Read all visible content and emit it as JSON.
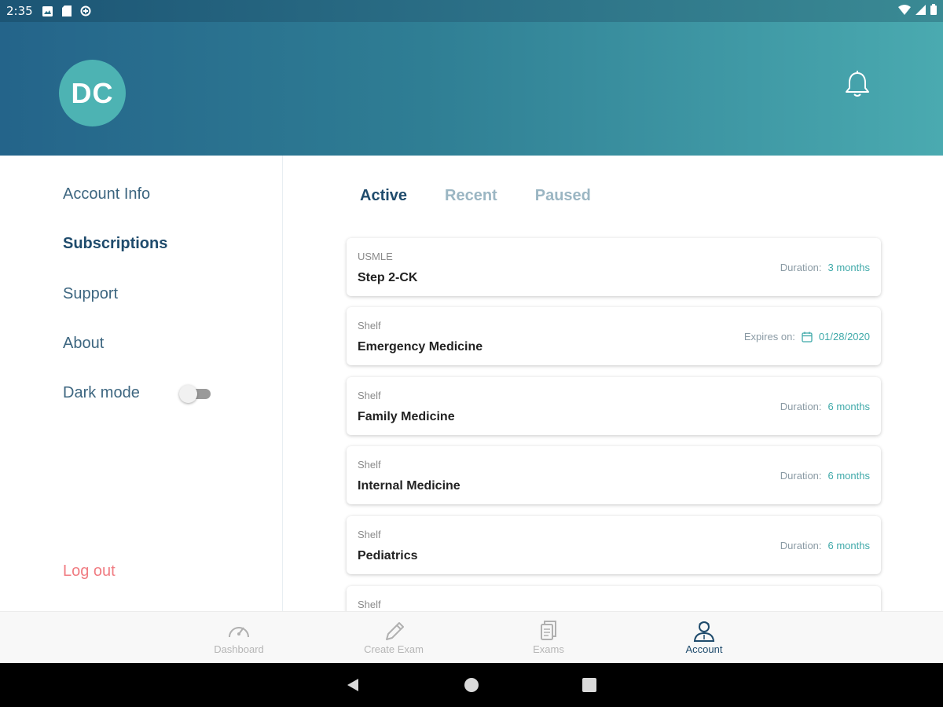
{
  "status_bar": {
    "time": "2:35"
  },
  "header": {
    "avatar_initials": "DC"
  },
  "sidebar": {
    "items": [
      {
        "label": "Account Info"
      },
      {
        "label": "Subscriptions"
      },
      {
        "label": "Support"
      },
      {
        "label": "About"
      },
      {
        "label": "Dark mode"
      }
    ],
    "dark_mode_on": false,
    "logout_label": "Log out"
  },
  "tabs": [
    {
      "label": "Active"
    },
    {
      "label": "Recent"
    },
    {
      "label": "Paused"
    }
  ],
  "subscriptions": [
    {
      "category": "USMLE",
      "name": "Step 2-CK",
      "meta_label": "Duration:",
      "meta_value": "3 months"
    },
    {
      "category": "Shelf",
      "name": "Emergency Medicine",
      "meta_label": "Expires on:",
      "meta_value": "01/28/2020"
    },
    {
      "category": "Shelf",
      "name": "Family Medicine",
      "meta_label": "Duration:",
      "meta_value": "6 months"
    },
    {
      "category": "Shelf",
      "name": "Internal Medicine",
      "meta_label": "Duration:",
      "meta_value": "6 months"
    },
    {
      "category": "Shelf",
      "name": "Pediatrics",
      "meta_label": "Duration:",
      "meta_value": "6 months"
    },
    {
      "category": "Shelf"
    }
  ],
  "bottom_nav": [
    {
      "label": "Dashboard"
    },
    {
      "label": "Create Exam"
    },
    {
      "label": "Exams"
    },
    {
      "label": "Account"
    }
  ],
  "colors": {
    "accent": "#3fa9a9",
    "primary_text": "#1f4b6c",
    "logout": "#f07c82",
    "avatar": "#4db3b3"
  },
  "icons": [
    "bell-icon",
    "dashboard-gauge-icon",
    "pencil-icon",
    "exams-icon",
    "account-icon",
    "calendar-icon"
  ]
}
